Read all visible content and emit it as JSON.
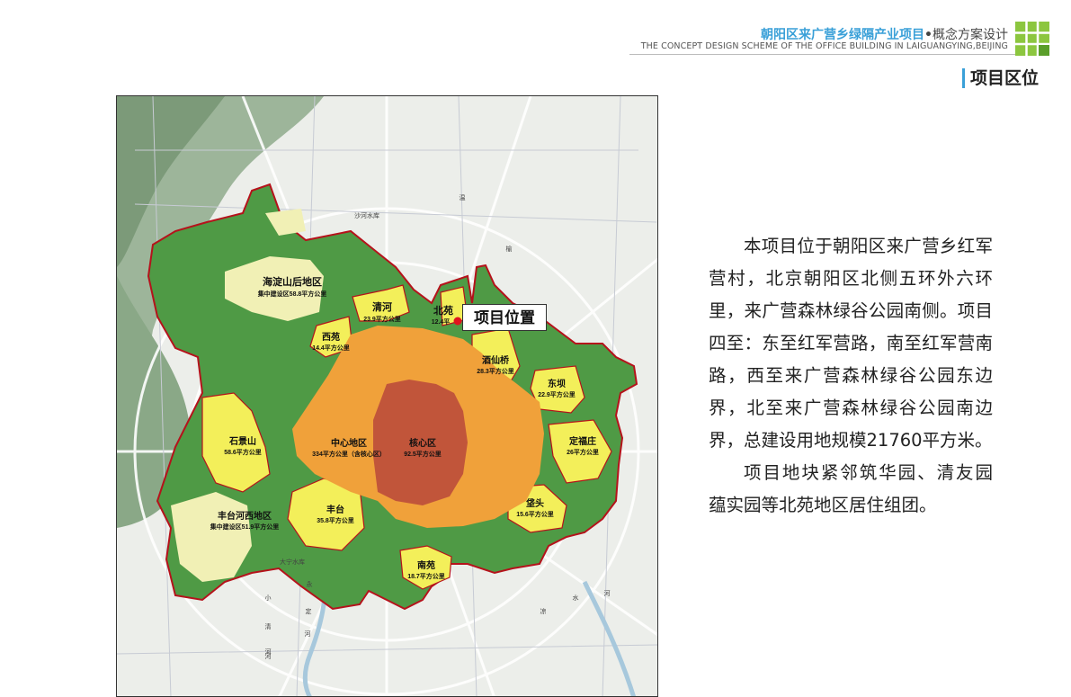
{
  "header": {
    "title_cn": "朝阳区来广营乡绿隔产业项目",
    "title_sep": "•",
    "title_sub": "概念方案设计",
    "title_en": "THE CONCEPT DESIGN SCHEME OF THE OFFICE BUILDING IN LAIGUANGYING,BEIJING",
    "section": "项目区位"
  },
  "map": {
    "project_label": "项目位置",
    "districts": [
      {
        "name": "海淀山后地区",
        "area": "集中建设区58.8平方公里"
      },
      {
        "name": "清河",
        "area": "23.9平方公里"
      },
      {
        "name": "北苑",
        "area": "12.4平"
      },
      {
        "name": "西苑",
        "area": "14.4平方公里"
      },
      {
        "name": "酒仙桥",
        "area": "28.3平方公里"
      },
      {
        "name": "东坝",
        "area": "22.9平方公里"
      },
      {
        "name": "石景山",
        "area": "58.6平方公里"
      },
      {
        "name": "中心地区",
        "area": "334平方公里（含核心区）"
      },
      {
        "name": "核心区",
        "area": "92.5平方公里"
      },
      {
        "name": "定福庄",
        "area": "26平方公里"
      },
      {
        "name": "丰台河西地区",
        "area": "集中建设区51.9平方公里"
      },
      {
        "name": "丰台",
        "area": "35.8平方公里"
      },
      {
        "name": "垡头",
        "area": "15.6平方公里"
      },
      {
        "name": "南苑",
        "area": "18.7平方公里"
      }
    ],
    "water_labels": [
      "沙河水库",
      "大宁水库",
      "温",
      "榆",
      "河",
      "凉",
      "水",
      "河",
      "小",
      "清",
      "河",
      "永",
      "定",
      "河"
    ]
  },
  "description": {
    "para1": "本项目位于朝阳区来广营乡红军营村，北京朝阳区北侧五环外六环里，来广营森林绿谷公园南侧。项目四至：东至红军营路，南至红军营南路，西至来广营森林绿谷公园东边界，北至来广营森林绿谷公园南边界，总建设用地规模21760平方米。",
    "para2": "项目地块紧邻筑华园、清友园　蕴实园等北苑地区居住组团。"
  },
  "colors": {
    "accent_blue": "#3aa0d8",
    "logo_green": "#8cc63f",
    "green_belt": "#4f9a45",
    "new_town_yellow": "#f3ef5a",
    "pale_yellow": "#f1f0b5",
    "central_orange": "#f0a13a",
    "core_red": "#c1553a",
    "boundary_red": "#b5121b"
  }
}
